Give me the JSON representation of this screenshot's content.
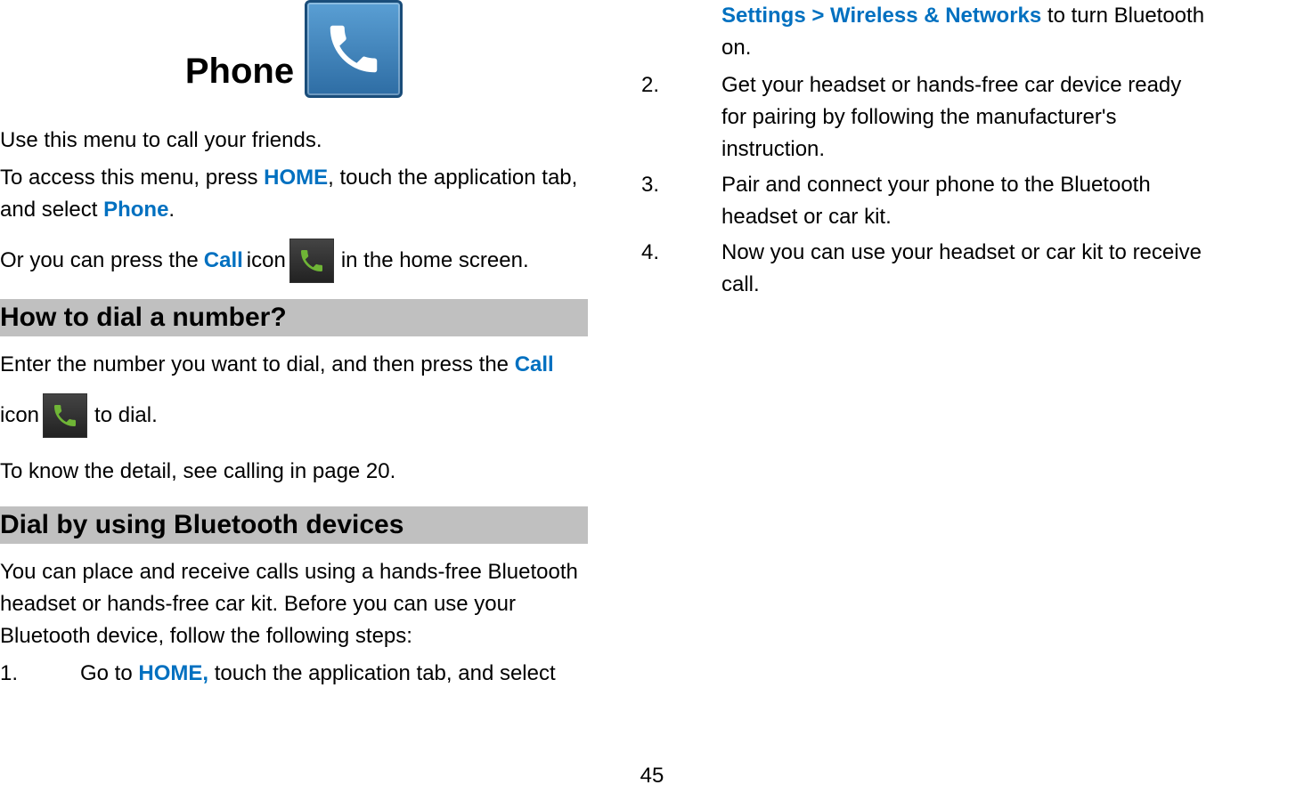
{
  "left": {
    "title": "Phone",
    "p1": "Use this menu to call your friends.",
    "p2_a": "To access this menu, press ",
    "p2_home": "HOME",
    "p2_b": ", touch the application tab, and select ",
    "p2_phone": "Phone",
    "p2_c": ".",
    "p3_a": "Or you can press the ",
    "p3_call": "Call",
    "p3_b": " icon ",
    "p3_c": " in the home screen.",
    "h1": "How to dial a number?",
    "p4_a": "Enter the number you want to dial, and then press the ",
    "p4_call": "Call",
    "p5_a": "icon ",
    "p5_b": " to dial.",
    "p6": "To know the detail, see calling in page 20.",
    "h2": "Dial by using Bluetooth devices",
    "p7": "You can place and receive calls using a hands-free Bluetooth headset or hands-free car kit. Before you can use your Bluetooth device, follow the following steps:",
    "li1_num": "1.",
    "li1_a": "Go to ",
    "li1_home": "HOME,",
    "li1_b": " touch the application tab, and select "
  },
  "right": {
    "cont_link": "Settings > Wireless & Networks",
    "cont_b": " to turn Bluetooth on.",
    "li2_num": "2.",
    "li2": "Get your headset or hands-free car device ready for pairing by following the manufacturer's instruction.",
    "li3_num": "3.",
    "li3": "Pair and connect your phone to the Bluetooth headset or car kit.",
    "li4_num": "4.",
    "li4": "Now you can use your headset or car kit to receive call."
  },
  "page_number": "45"
}
